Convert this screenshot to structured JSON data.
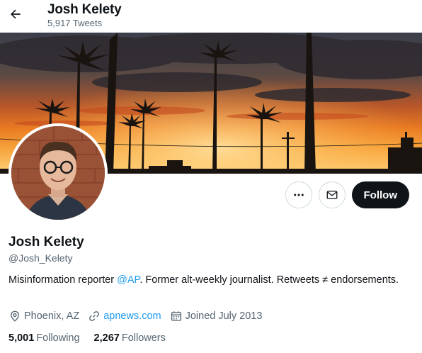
{
  "header": {
    "name": "Josh Kelety",
    "tweet_count": "5,917 Tweets",
    "back_icon": "arrow-left-icon"
  },
  "banner": {
    "description_icon": "sunset-palm-trees-photo"
  },
  "profile": {
    "name": "Josh Kelety",
    "handle": "@Josh_Kelety",
    "bio_before": "Misinformation reporter ",
    "bio_mention": "@AP",
    "bio_after": ". Former alt-weekly journalist. Retweets ≠ endorsements.",
    "location": "Phoenix, AZ",
    "website": "apnews.com",
    "joined": "Joined July 2013"
  },
  "actions": {
    "more_icon": "more-horizontal-icon",
    "message_icon": "envelope-icon",
    "follow_label": "Follow"
  },
  "stats": {
    "following_count": "5,001",
    "following_label": "Following",
    "followers_count": "2,267",
    "followers_label": "Followers"
  },
  "colors": {
    "accent": "#1d9bf0",
    "text": "#0f1419",
    "secondary": "#536471",
    "follow_bg": "#0f1419"
  }
}
